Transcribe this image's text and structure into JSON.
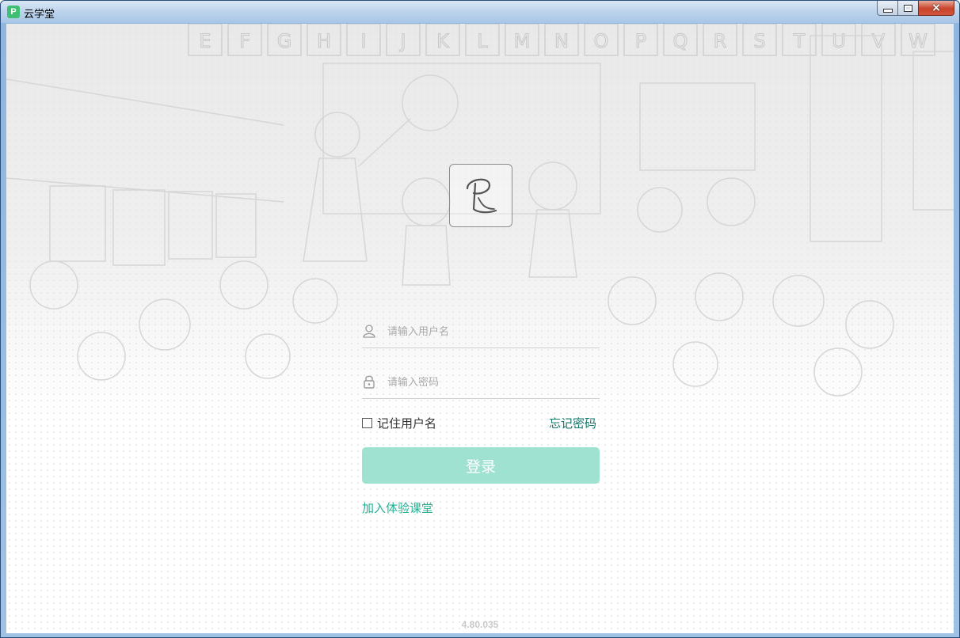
{
  "window": {
    "title": "云学堂",
    "app_icon_letter": "P",
    "controls": {
      "minimize": "minimize",
      "maximize": "maximize",
      "close": "×"
    }
  },
  "background": {
    "alphabet": [
      "E",
      "F",
      "G",
      "H",
      "I",
      "J",
      "K",
      "L",
      "M",
      "N",
      "O",
      "P",
      "Q",
      "R",
      "S",
      "T",
      "U",
      "V",
      "W"
    ]
  },
  "login": {
    "username_placeholder": "请输入用户名",
    "password_placeholder": "请输入密码",
    "remember_label": "记住用户名",
    "remember_checked": false,
    "forgot_label": "忘记密码",
    "submit_label": "登录",
    "join_label": "加入体验课堂"
  },
  "footer": {
    "version": "4.80.035"
  },
  "colors": {
    "accent": "#26b093",
    "button_bg": "#9fe2d2",
    "forgot": "#14756a"
  }
}
